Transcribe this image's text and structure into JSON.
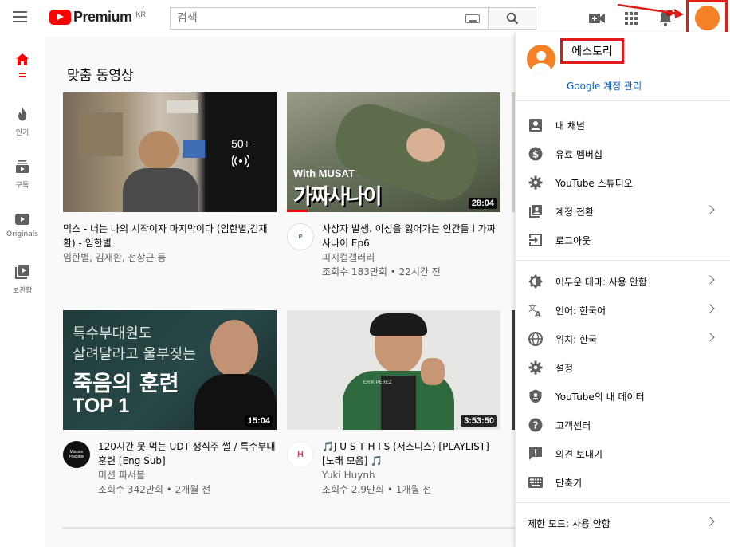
{
  "header": {
    "logo_text": "Premium",
    "logo_region": "KR",
    "search_placeholder": "검색",
    "notification_count": ""
  },
  "sidebar": {
    "items": [
      {
        "label": "",
        "icon": "home-icon"
      },
      {
        "label": "인기",
        "icon": "fire-icon"
      },
      {
        "label": "구독",
        "icon": "subscriptions-icon"
      },
      {
        "label": "Originals",
        "icon": "originals-icon"
      },
      {
        "label": "보관함",
        "icon": "library-icon"
      }
    ]
  },
  "main": {
    "section_title": "맞춤 동영상",
    "videos": [
      {
        "title": "믹스 - 너는 나의 시작이자 마지막이다 (임한별,김재환) - 임한별",
        "channel": "임한별, 김재환, 전상근 등",
        "views": "",
        "badge": "50+",
        "duration": ""
      },
      {
        "title": "사상자 발생. 이성을 잃어가는 인간들 l 가짜사나이 Ep6",
        "channel": "피지컬갤러리",
        "views": "조회수 183만회 • 22시간 전",
        "duration": "28:04",
        "thumb_text_top": "With MUSAT",
        "thumb_text_main": "가짜사나이"
      },
      {
        "title": "120시간 못 먹는 UDT 생식주 썰 / 특수부대 훈련 [Eng Sub]",
        "channel": "미션 파서블",
        "views": "조회수 342만회 • 2개월 전",
        "duration": "15:04",
        "thumb_line1": "특수부대원도",
        "thumb_line2": "살려달라고 울부짖는",
        "thumb_line3": "죽음의 훈련",
        "thumb_line4": "TOP 1",
        "chan_avatar_text": "Mission Possible"
      },
      {
        "title": "🎵J U S T H I S (저스디스) [PLAYLIST] [노래 모음] 🎵",
        "channel": "Yuki Huynh",
        "views": "조회수 2.9만회 • 1개월 전",
        "duration": "3:53:50",
        "thumb_text": "ERIK PEREZ"
      }
    ]
  },
  "menu": {
    "user_name": "에스토리",
    "manage_account": "Google 계정 관리",
    "items": [
      {
        "label": "내 채널",
        "icon": "account-box-icon",
        "chevron": false
      },
      {
        "label": "유료 멤버십",
        "icon": "dollar-icon",
        "chevron": false
      },
      {
        "label": "YouTube 스튜디오",
        "icon": "gear-icon",
        "chevron": false
      },
      {
        "label": "계정 전환",
        "icon": "switch-account-icon",
        "chevron": true
      },
      {
        "label": "로그아웃",
        "icon": "logout-icon",
        "chevron": false
      },
      {
        "label": "어두운 테마: 사용 안함",
        "icon": "dark-theme-icon",
        "chevron": true
      },
      {
        "label": "언어: 한국어",
        "icon": "translate-icon",
        "chevron": true
      },
      {
        "label": "위치: 한국",
        "icon": "globe-icon",
        "chevron": true
      },
      {
        "label": "설정",
        "icon": "settings-icon",
        "chevron": false
      },
      {
        "label": "YouTube의 내 데이터",
        "icon": "shield-person-icon",
        "chevron": false
      },
      {
        "label": "고객센터",
        "icon": "help-icon",
        "chevron": false
      },
      {
        "label": "의견 보내기",
        "icon": "feedback-icon",
        "chevron": false
      },
      {
        "label": "단축키",
        "icon": "keyboard-icon",
        "chevron": false
      }
    ],
    "restricted_mode": "제한 모드: 사용 안함"
  },
  "colors": {
    "brand_red": "#ff0000",
    "avatar_orange": "#f58025",
    "link_blue": "#065fd4",
    "highlight_red": "#e21b1b"
  }
}
